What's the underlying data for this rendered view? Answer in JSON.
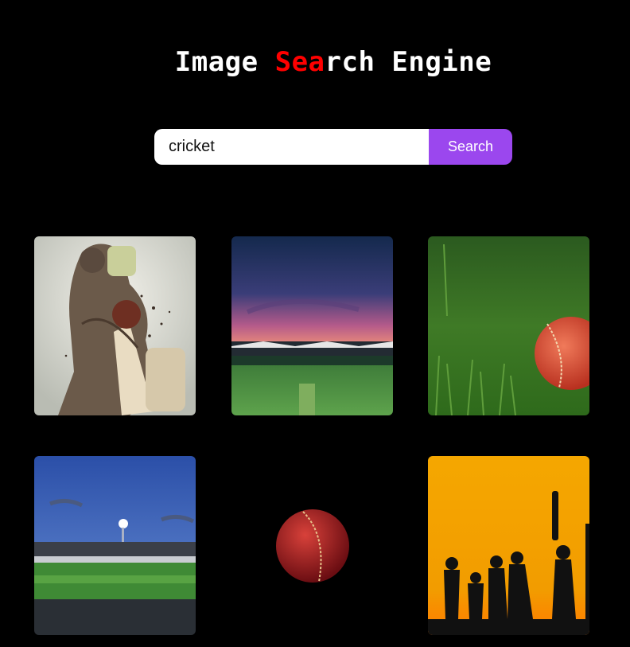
{
  "header": {
    "title_part1": "Image ",
    "title_accent": "Sea",
    "title_part2": "rch Engine",
    "accent_color": "#ff0000"
  },
  "search": {
    "value": "cricket",
    "button_label": "Search",
    "button_color": "#9b47ee"
  },
  "results": [
    {
      "subject": "batsman hitting ball"
    },
    {
      "subject": "stadium at sunset"
    },
    {
      "subject": "red cricket ball on grass"
    },
    {
      "subject": "floodlit cricket ground"
    },
    {
      "subject": "red cricket ball on black"
    },
    {
      "subject": "silhouettes with bat at sunset"
    }
  ]
}
